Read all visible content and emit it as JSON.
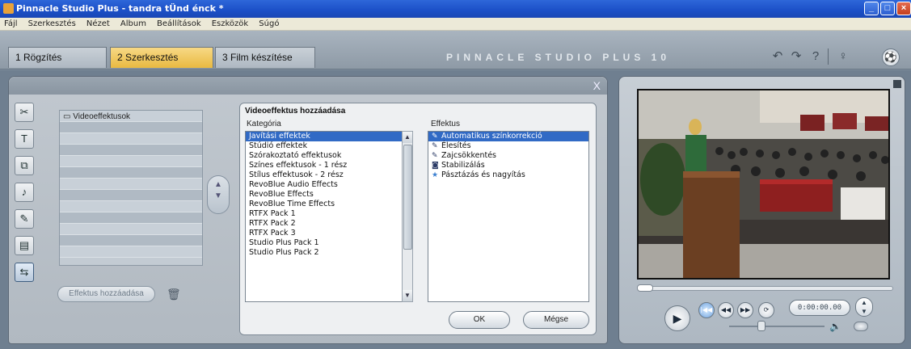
{
  "window": {
    "title": "Pinnacle Studio Plus - tandra tÜnd énck *",
    "min_label": "_",
    "max_label": "□",
    "close_label": "×"
  },
  "menu": [
    "Fájl",
    "Szerkesztés",
    "Nézet",
    "Album",
    "Beállítások",
    "Eszközök",
    "Súgó"
  ],
  "tabs": [
    {
      "label": "1 Rögzítés",
      "active": false
    },
    {
      "label": "2 Szerkesztés",
      "active": true
    },
    {
      "label": "3 Film készítése",
      "active": false
    }
  ],
  "brand": "PINNACLE STUDIO PLUS 10",
  "header_icons": {
    "undo": "↶",
    "redo": "↷",
    "help": "?",
    "info": "♀",
    "ball": "⚽"
  },
  "album": {
    "close": "X",
    "effects_header": "Videoeffektusok",
    "add_button": "Effektus hozzáadása",
    "tool_glyphs": [
      "✂",
      "T",
      "⧉",
      "♪",
      "✎",
      "▤",
      "⇆"
    ]
  },
  "dialog": {
    "title": "Videoeffektus hozzáadása",
    "category_label": "Kategória",
    "effect_label": "Effektus",
    "categories": [
      "Javítási effektek",
      "Stúdió effektek",
      "Szórakoztató effektusok",
      "Színes effektusok - 1 rész",
      "Stílus effektusok - 2 rész",
      "RevoBlue Audio Effects",
      "RevoBlue Effects",
      "RevoBlue Time Effects",
      "RTFX Pack 1",
      "RTFX Pack 2",
      "RTFX Pack 3",
      "Studio Plus Pack 1",
      "Studio Plus Pack 2"
    ],
    "effects": [
      "Automatikus színkorrekció",
      "Élesítés",
      "Zajcsökkentés",
      "Stabilizálás",
      "Pásztázás és nagyítás"
    ],
    "ok": "OK",
    "cancel": "Mégse"
  },
  "preview": {
    "timecode": "0:00:00.00",
    "play": "▶",
    "first": "|◀◀",
    "rewind": "◀◀",
    "forward": "▶▶",
    "loop": "⟳"
  }
}
